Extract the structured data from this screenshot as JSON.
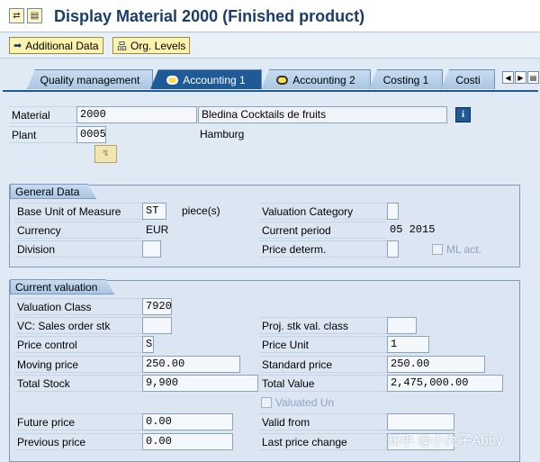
{
  "title": "Display Material 2000 (Finished product)",
  "appbar": {
    "additional_data": "Additional Data",
    "org_levels": "Org. Levels"
  },
  "tabs": [
    {
      "label": "Quality management",
      "icon": "none"
    },
    {
      "label": "Accounting 1",
      "icon": "status-icon"
    },
    {
      "label": "Accounting 2",
      "icon": "status-icon"
    },
    {
      "label": "Costing 1",
      "icon": "none"
    },
    {
      "label": "Costi",
      "icon": "none"
    }
  ],
  "header": {
    "material_label": "Material",
    "material_value": "2000",
    "material_desc": "Bledina Cocktails de fruits",
    "plant_label": "Plant",
    "plant_value": "0005",
    "plant_desc": "Hamburg"
  },
  "general_data": {
    "title": "General Data",
    "base_uom_label": "Base Unit of Measure",
    "base_uom_value": "ST",
    "base_uom_text": "piece(s)",
    "valuation_category_label": "Valuation Category",
    "valuation_category_value": "",
    "currency_label": "Currency",
    "currency_value": "EUR",
    "current_period_label": "Current period",
    "current_period_value": "05 2015",
    "division_label": "Division",
    "division_value": "",
    "price_determ_label": "Price determ.",
    "price_determ_value": "",
    "ml_act_label": "ML act."
  },
  "current_valuation": {
    "title": "Current valuation",
    "valuation_class_label": "Valuation Class",
    "valuation_class_value": "7920",
    "vc_sales_label": "VC: Sales order stk",
    "vc_sales_value": "",
    "proj_stk_label": "Proj. stk val. class",
    "proj_stk_value": "",
    "price_control_label": "Price control",
    "price_control_value": "S",
    "price_unit_label": "Price Unit",
    "price_unit_value": "1",
    "moving_price_label": "Moving price",
    "moving_price_value": "250.00",
    "standard_price_label": "Standard price",
    "standard_price_value": "250.00",
    "total_stock_label": "Total Stock",
    "total_stock_value": "9,900",
    "total_value_label": "Total Value",
    "total_value_value": "2,475,000.00",
    "valuated_un_label": "Valuated Un",
    "future_price_label": "Future price",
    "future_price_value": "0.00",
    "valid_from_label": "Valid from",
    "valid_from_value": "",
    "previous_price_label": "Previous price",
    "previous_price_value": "0.00",
    "last_price_change_label": "Last price change",
    "last_price_change_value": ""
  },
  "watermark": "知乎 @小丸子Abby"
}
